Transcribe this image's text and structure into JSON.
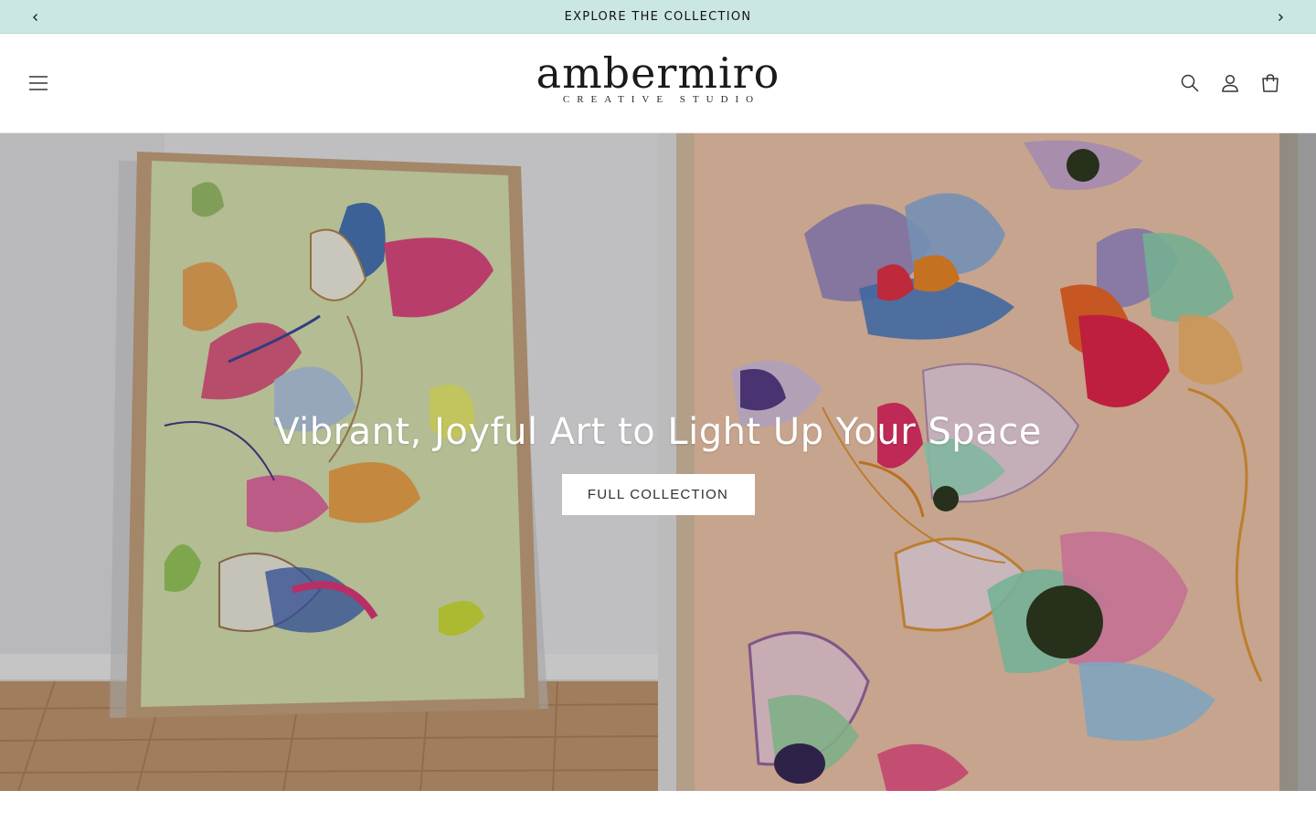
{
  "announcement": {
    "text": "EXPLORE THE COLLECTION",
    "prev_icon": "chevron-left-icon",
    "next_icon": "chevron-right-icon"
  },
  "header": {
    "menu_icon": "hamburger-menu-icon",
    "logo": {
      "name": "ambermiro",
      "tagline": "CREATIVE STUDIO"
    },
    "icons": [
      "search-icon",
      "account-icon",
      "cart-icon"
    ]
  },
  "hero": {
    "heading": "Vibrant, Joyful Art to Light Up Your Space",
    "button_label": "FULL COLLECTION"
  },
  "colors": {
    "announcement_bg": "#cbe7e4",
    "button_bg": "#ffffff",
    "left_canvas": "#dbe6b4",
    "right_canvas": "#f3c8ac"
  }
}
